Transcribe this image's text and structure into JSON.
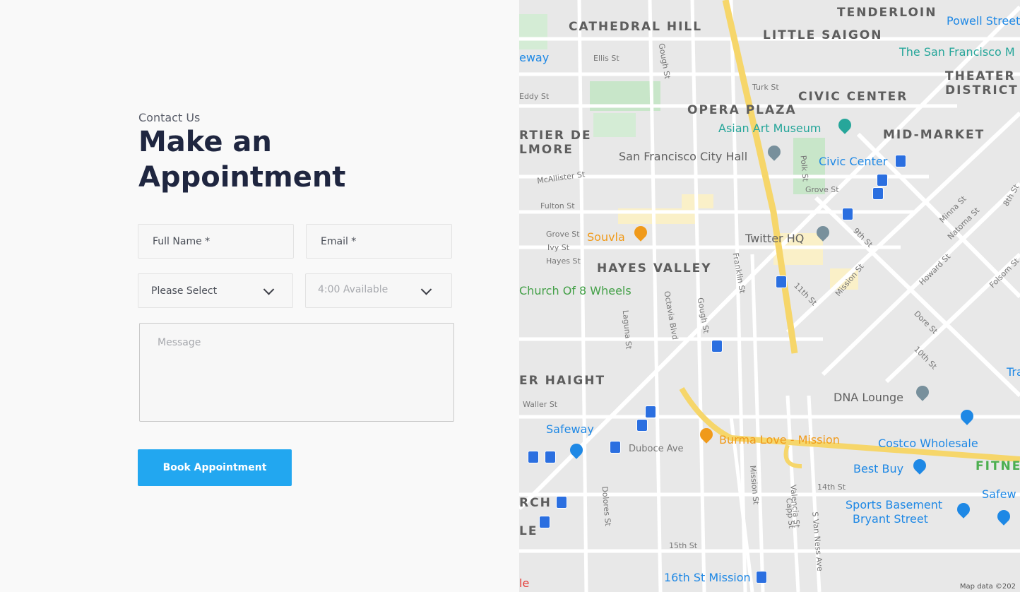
{
  "form": {
    "eyebrow": "Contact Us",
    "title": "Make an Appointment",
    "full_name_placeholder": "Full Name *",
    "email_placeholder": "Email *",
    "service_select_value": "Please Select",
    "time_select_value": "4:00 Available",
    "message_placeholder": "Message",
    "submit_label": "Book Appointment",
    "accent_color": "#22a7f0"
  },
  "map": {
    "districts": [
      "TENDERLOIN",
      "CATHEDRAL HILL",
      "LITTLE SAIGON",
      "THEATER",
      "DISTRICT",
      "CIVIC CENTER",
      "OPERA PLAZA",
      "MID-MARKET",
      "RTIER DE",
      "LMORE",
      "HAYES VALLEY",
      "ER HAIGHT",
      "FITNESS",
      "RCH",
      "LE"
    ],
    "pois": [
      "Powell Street",
      "The San Francisco M",
      "Asian Art Museum",
      "San Francisco City Hall",
      "Civic Center",
      "Souvla",
      "Twitter HQ",
      "Church Of 8 Wheels",
      "DNA Lounge",
      "Safeway",
      "Burma Love - Mission",
      "Costco Wholesale",
      "Best Buy",
      "Sports Basement",
      "Bryant Street",
      "Safew",
      "16th St Mission",
      "eway",
      "Tra"
    ],
    "streets": [
      "Ellis St",
      "Eddy St",
      "Turk St",
      "Gough St",
      "McAllister St",
      "Fulton St",
      "Grove St",
      "Ivy St",
      "Hayes St",
      "Franklin St",
      "Octavia Blvd",
      "Laguna St",
      "Gough St",
      "Waller St",
      "Duboce Ave",
      "Dolores St",
      "Mission St",
      "Valencia St",
      "S Van Ness Ave",
      "Howard St",
      "Folsom St",
      "9th St",
      "Minna St",
      "Natoma St",
      "11th St",
      "10th St",
      "Dore St",
      "15th St",
      "14th St",
      "Capp St",
      "Mission St",
      "Polk St",
      "Grove St",
      "8th St"
    ],
    "attribution": "Map data ©202",
    "google_mark": "le"
  }
}
